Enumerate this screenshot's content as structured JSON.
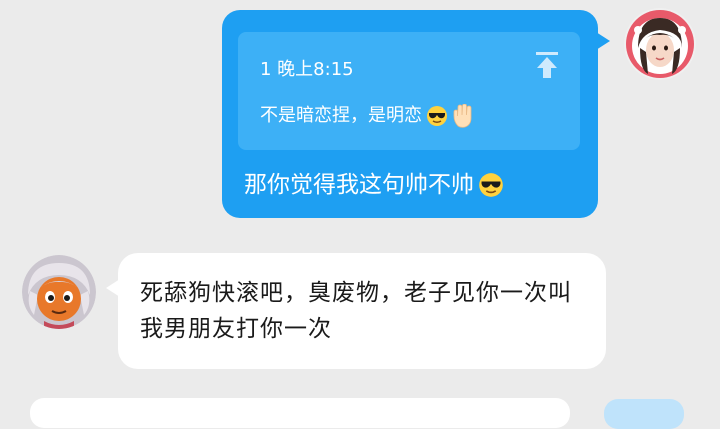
{
  "conversation": {
    "sent_message": {
      "quote": {
        "meta": "1 晚上8:15",
        "text": "不是暗恋捏，是明恋",
        "emojis": [
          "sunglasses-emoji",
          "waving-hand-emoji"
        ]
      },
      "text": "那你觉得我这句帅不帅",
      "emoji": "sunglasses-emoji"
    },
    "received_message": {
      "text": "死舔狗快滚吧，臭废物，老子见你一次叫我男朋友打你一次"
    }
  },
  "colors": {
    "background": "#ebebeb",
    "sent_bubble": "#1e9ff2",
    "quote_box": "#3db0f6",
    "received_bubble": "#ffffff"
  }
}
